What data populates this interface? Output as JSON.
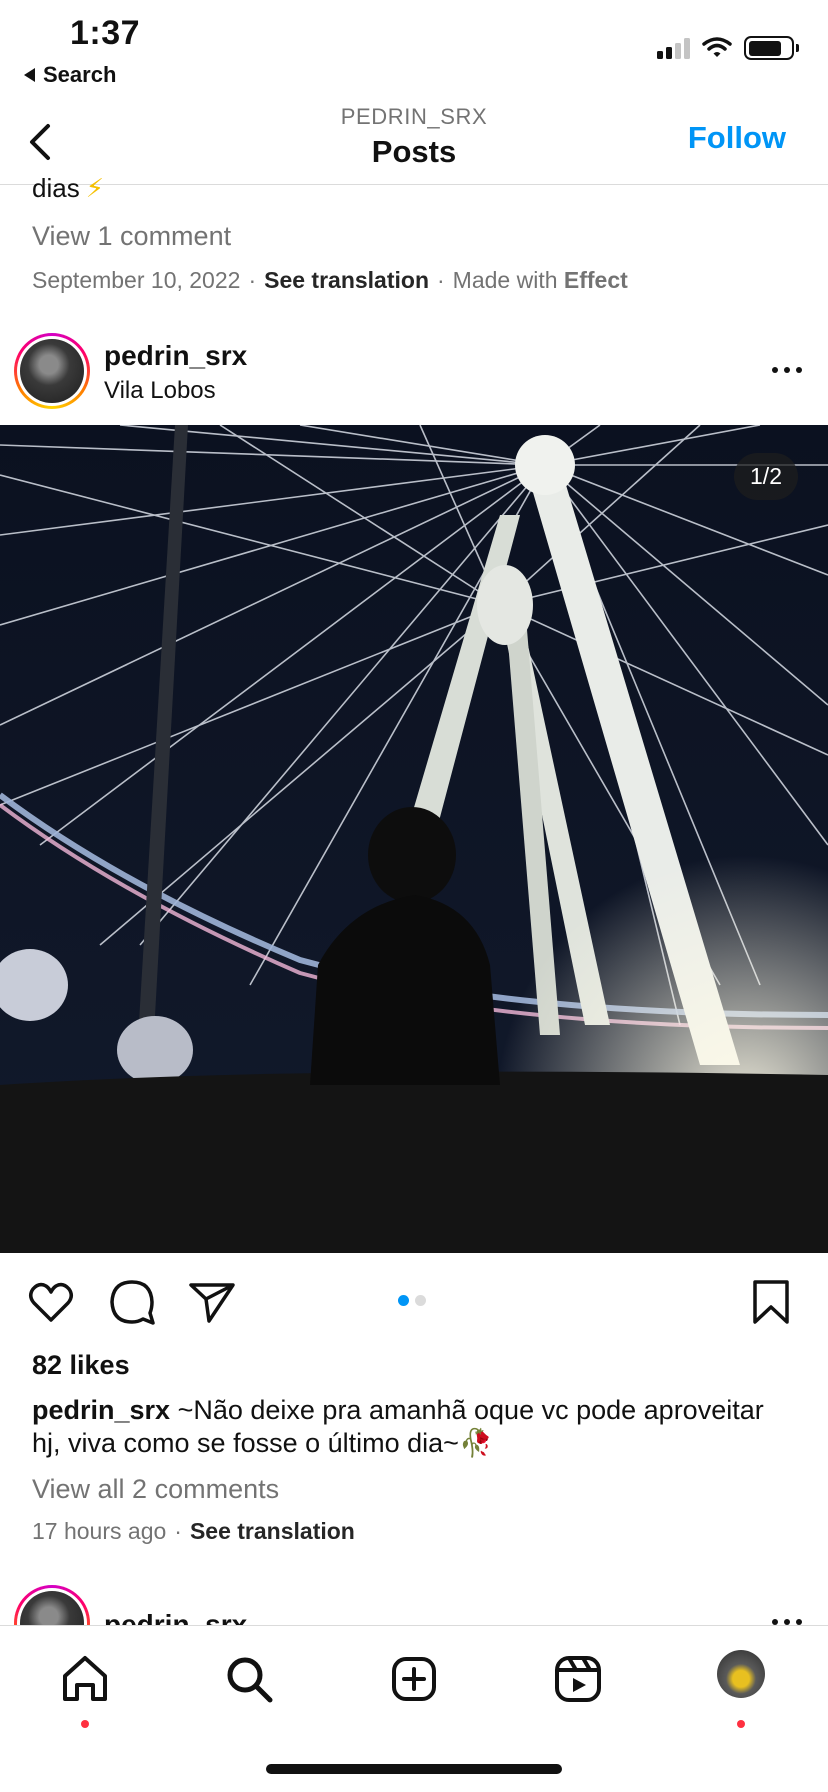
{
  "status_bar": {
    "time": "1:37",
    "back_app": "Search"
  },
  "nav": {
    "username": "PEDRIN_SRX",
    "title": "Posts",
    "follow_label": "Follow"
  },
  "previous_post": {
    "caption_tail": "dias",
    "caption_emoji": "⚡",
    "view_comments": "View 1 comment",
    "date": "September 10, 2022",
    "see_translation": "See translation",
    "made_with_prefix": "Made with",
    "made_with_effect": "Effect"
  },
  "post": {
    "username": "pedrin_srx",
    "location": "Vila Lobos",
    "image_counter": "1/2",
    "carousel_current": 1,
    "carousel_total": 2,
    "likes": "82 likes",
    "caption_user": "pedrin_srx",
    "caption_text": "~Não deixe pra amanhã oque vc pode aproveitar hj, viva como se fosse o último dia~🥀",
    "view_all_comments": "View all 2 comments",
    "time_ago": "17 hours ago",
    "see_translation": "See translation"
  },
  "next_post": {
    "username": "pedrin_srx"
  },
  "tab_bar": {
    "items": [
      "home-icon",
      "search-icon",
      "new-post-icon",
      "reels-icon",
      "profile-avatar"
    ],
    "notification_dots": [
      "home",
      "profile"
    ]
  },
  "colors": {
    "accent": "#0095f6",
    "notification": "#ff3040",
    "secondary_text": "#737373"
  }
}
